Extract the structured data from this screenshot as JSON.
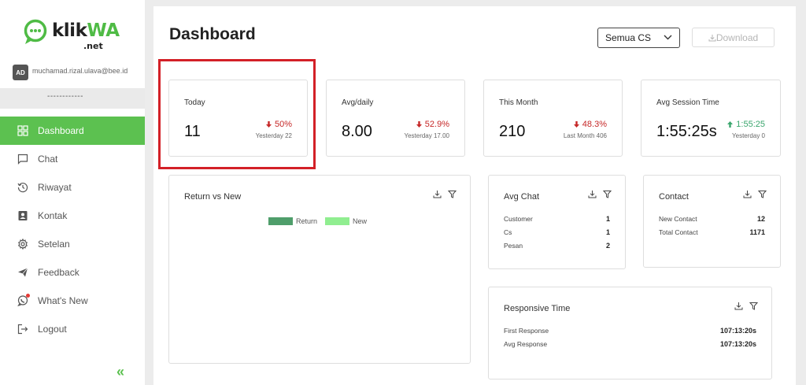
{
  "brand": {
    "name_part1": "klik",
    "name_part2": "WA",
    "suffix": ".net",
    "accent": "#5cc150"
  },
  "user": {
    "initials": "AD",
    "email": "muchamad.rizal.ulava@bee.id",
    "role": "------------"
  },
  "nav": {
    "items": [
      {
        "label": "Dashboard",
        "icon": "grid-icon",
        "active": true
      },
      {
        "label": "Chat",
        "icon": "chat-icon"
      },
      {
        "label": "Riwayat",
        "icon": "history-icon"
      },
      {
        "label": "Kontak",
        "icon": "contact-icon"
      },
      {
        "label": "Setelan",
        "icon": "gear-icon"
      },
      {
        "label": "Feedback",
        "icon": "send-icon"
      },
      {
        "label": "What's New",
        "icon": "whatsapp-icon"
      },
      {
        "label": "Logout",
        "icon": "logout-icon"
      }
    ],
    "collapse_icon": "double-chevron-left-icon"
  },
  "header": {
    "title": "Dashboard",
    "filter_value": "Semua CS",
    "download_label": "Download"
  },
  "stats": [
    {
      "label": "Today",
      "value": "11",
      "change": "50%",
      "direction": "down",
      "sub": "Yesterday 22"
    },
    {
      "label": "Avg/daily",
      "value": "8.00",
      "change": "52.9%",
      "direction": "down",
      "sub": "Yesterday 17.00"
    },
    {
      "label": "This Month",
      "value": "210",
      "change": "48.3%",
      "direction": "down",
      "sub": "Last Month 406"
    },
    {
      "label": "Avg Session Time",
      "value": "1:55:25s",
      "change": "1:55:25",
      "direction": "up",
      "sub": "Yesterday 0"
    }
  ],
  "return_vs_new": {
    "title": "Return vs New",
    "legend": [
      {
        "name": "Return",
        "color": "#4f9e6b"
      },
      {
        "name": "New",
        "color": "#90ee90"
      }
    ]
  },
  "avg_chat": {
    "title": "Avg Chat",
    "rows": [
      {
        "label": "Customer",
        "value": "1"
      },
      {
        "label": "Cs",
        "value": "1"
      },
      {
        "label": "Pesan",
        "value": "2"
      }
    ]
  },
  "contact": {
    "title": "Contact",
    "rows": [
      {
        "label": "New Contact",
        "value": "12"
      },
      {
        "label": "Total Contact",
        "value": "1171"
      }
    ]
  },
  "responsive_time": {
    "title": "Responsive Time",
    "rows": [
      {
        "label": "First Response",
        "value": "107:13:20s"
      },
      {
        "label": "Avg Response",
        "value": "107:13:20s"
      }
    ]
  },
  "colors": {
    "down": "#c62828",
    "up": "#3aa66d",
    "highlight": "#d32027"
  }
}
